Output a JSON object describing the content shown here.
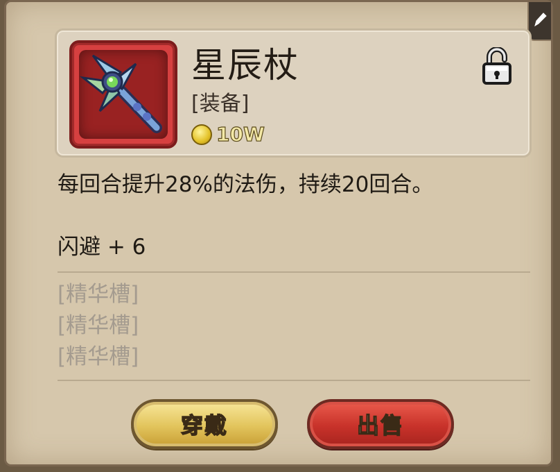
{
  "item": {
    "name": "星辰杖",
    "type": "[装备]",
    "price": "10W",
    "icon": "star-staff-icon",
    "locked": false
  },
  "description": "每回合提升28%的法伤，持续20回合。",
  "stat": "闪避 + 6",
  "slots": [
    "[精华槽]",
    "[精华槽]",
    "[精华槽]"
  ],
  "buttons": {
    "wear": "穿戴",
    "sell": "出售"
  },
  "colors": {
    "panel": "#d6c7ac",
    "icon_frame": "#d64040",
    "wear_button": "#e2c45c",
    "sell_button": "#c8322a",
    "slot_text": "#a49b8f"
  }
}
